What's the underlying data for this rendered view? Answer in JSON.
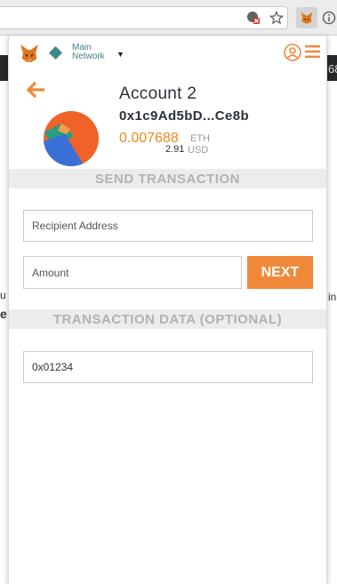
{
  "background": {
    "right_glyph_1": "68",
    "left_glyph_1": "u",
    "left_glyph_2": "e",
    "right_glyph_2": "in"
  },
  "header": {
    "network_line1": "Main",
    "network_line2": "Network",
    "network_color": "#3f7f8a"
  },
  "account": {
    "name": "Account 2",
    "address": "0x1c9Ad5bD...Ce8b",
    "balance_eth": "0.007688",
    "eth_unit": "ETH",
    "balance_usd": "2.91",
    "usd_unit": "USD"
  },
  "send": {
    "section_title": "SEND TRANSACTION",
    "recipient_placeholder": "Recipient Address",
    "amount_placeholder": "Amount",
    "next_label": "NEXT",
    "data_section_title": "TRANSACTION DATA (OPTIONAL)",
    "data_value": "0x01234"
  },
  "colors": {
    "accent": "#f6851b",
    "button": "#f0883a",
    "section_bg": "#ececec"
  },
  "icons": [
    "translate-icon",
    "star-icon",
    "info-icon",
    "metamask-fox-icon",
    "network-diamond-icon",
    "caret-down-icon",
    "account-switch-icon",
    "hamburger-menu-icon",
    "back-arrow-icon"
  ]
}
